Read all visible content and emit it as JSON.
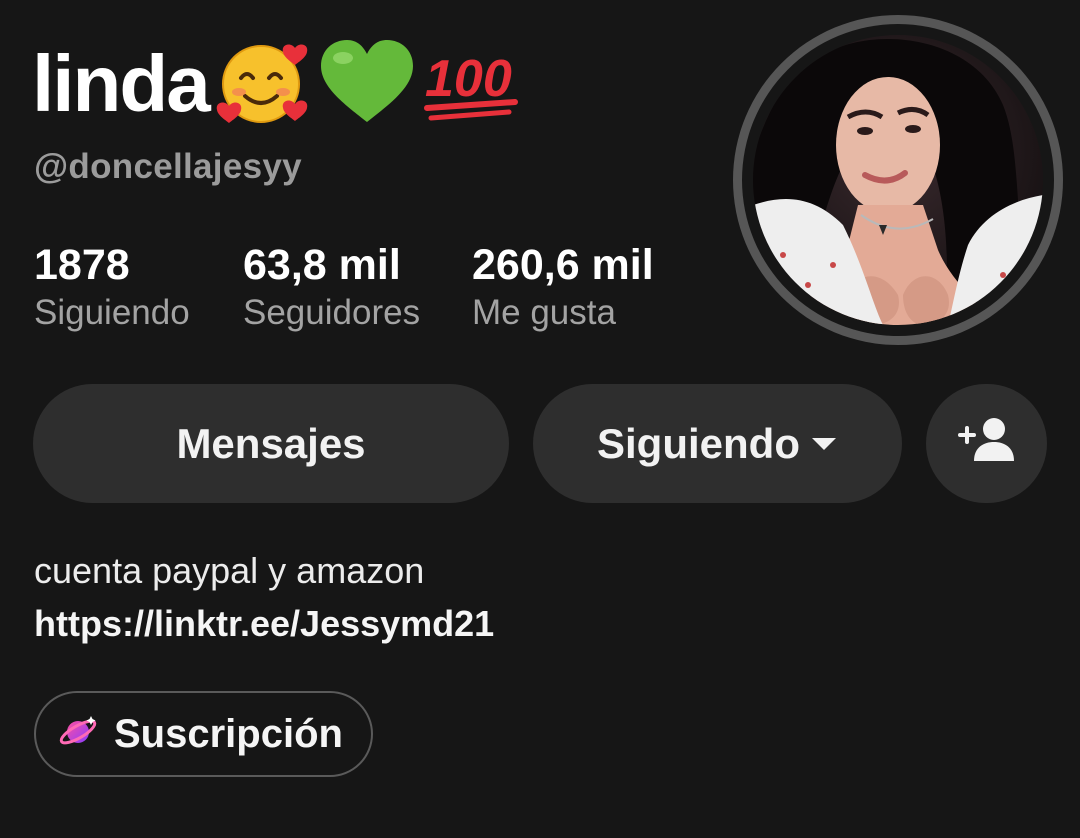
{
  "profile": {
    "display_name": "linda",
    "name_emojis": [
      "smiling-face-with-hearts",
      "green-heart",
      "hundred-points"
    ],
    "username": "@doncellajesyy",
    "avatar_icon": "profile-photo"
  },
  "stats": [
    {
      "value": "1878",
      "label": "Siguiendo"
    },
    {
      "value": "63,8 mil",
      "label": "Seguidores"
    },
    {
      "value": "260,6 mil",
      "label": "Me gusta"
    }
  ],
  "actions": {
    "messages_label": "Mensajes",
    "following_label": "Siguiendo",
    "add_friend_icon": "add-user-icon"
  },
  "bio": {
    "text": "cuenta paypal y amazon",
    "link": "https://linktr.ee/Jessymd21"
  },
  "subscription": {
    "label": "Suscripción",
    "icon": "planet-icon"
  },
  "colors": {
    "background": "#161616",
    "button_bg": "#2e2e2e",
    "secondary_text": "#9b9b9b"
  }
}
